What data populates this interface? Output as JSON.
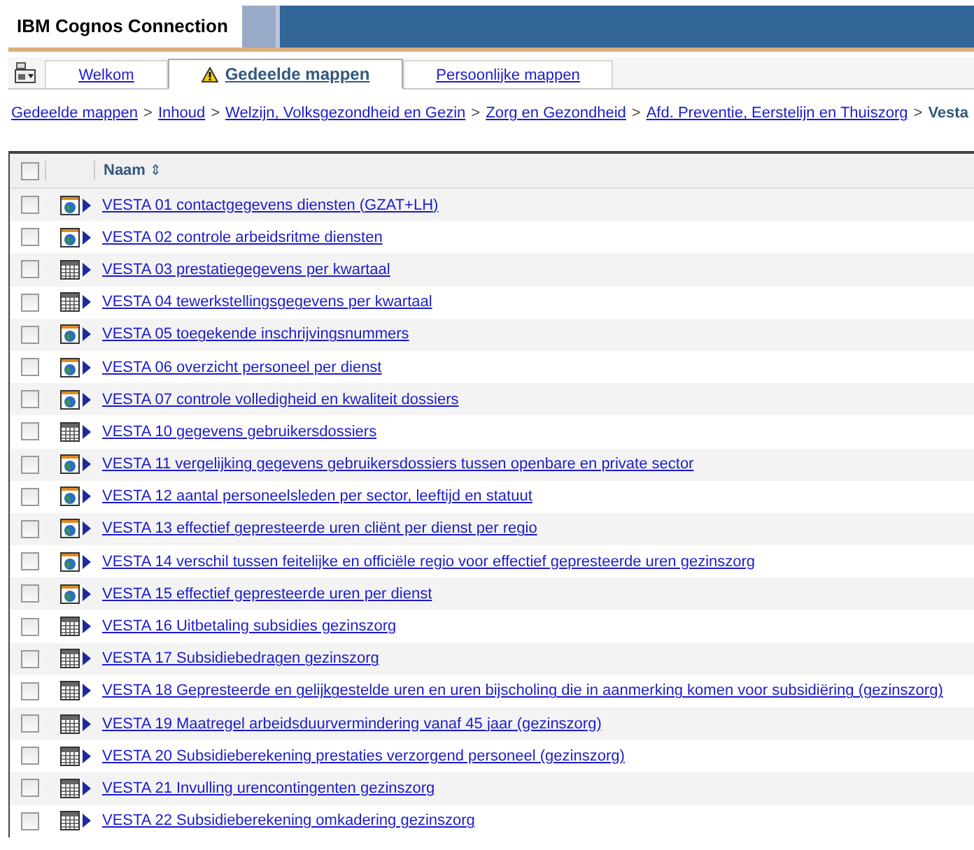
{
  "header": {
    "title": "IBM Cognos Connection"
  },
  "tabs": [
    {
      "label": "Welkom",
      "selected": false,
      "warning": false
    },
    {
      "label": "Gedeelde mappen",
      "selected": true,
      "warning": true
    },
    {
      "label": "Persoonlijke mappen",
      "selected": false,
      "warning": false
    }
  ],
  "breadcrumb": {
    "links": [
      "Gedeelde mappen",
      "Inhoud",
      "Welzijn, Volksgezondheid en Gezin",
      "Zorg en Gezondheid",
      "Afd. Preventie, Eerstelijn en Thuiszorg"
    ],
    "separator": ">",
    "current": "Vesta"
  },
  "table": {
    "header_checked": false,
    "columns": [
      "Naam"
    ],
    "sort_icon": "⇕",
    "rows": [
      {
        "kind": "report",
        "name": "VESTA 01 contactgegevens diensten (GZAT+LH)",
        "checked": false
      },
      {
        "kind": "report",
        "name": "VESTA 02 controle arbeidsritme diensten",
        "checked": false
      },
      {
        "kind": "analysis",
        "name": "VESTA 03 prestatiegegevens per kwartaal",
        "checked": false
      },
      {
        "kind": "analysis",
        "name": "VESTA 04 tewerkstellingsgegevens per kwartaal",
        "checked": false
      },
      {
        "kind": "report",
        "name": "VESTA 05 toegekende inschrijvingsnummers",
        "checked": false
      },
      {
        "kind": "report",
        "name": "VESTA 06 overzicht personeel per dienst",
        "checked": false
      },
      {
        "kind": "report",
        "name": "VESTA 07 controle volledigheid en kwaliteit dossiers",
        "checked": false
      },
      {
        "kind": "analysis",
        "name": "VESTA 10 gegevens gebruikersdossiers",
        "checked": false
      },
      {
        "kind": "report",
        "name": "VESTA 11 vergelijking gegevens gebruikersdossiers tussen openbare en private sector",
        "checked": false
      },
      {
        "kind": "report",
        "name": "VESTA 12 aantal personeelsleden per sector, leeftijd en statuut",
        "checked": false
      },
      {
        "kind": "report",
        "name": "VESTA 13 effectief gepresteerde uren cliënt per dienst per regio",
        "checked": false
      },
      {
        "kind": "report",
        "name": "VESTA 14 verschil tussen feitelijke en officiële regio voor effectief gepresteerde uren gezinszorg",
        "checked": false
      },
      {
        "kind": "report",
        "name": "VESTA 15 effectief gepresteerde uren per dienst",
        "checked": false
      },
      {
        "kind": "analysis",
        "name": "VESTA 16 Uitbetaling subsidies gezinszorg",
        "checked": false
      },
      {
        "kind": "analysis",
        "name": "VESTA 17 Subsidiebedragen gezinszorg",
        "checked": false
      },
      {
        "kind": "analysis",
        "name": "VESTA 18 Gepresteerde en gelijkgestelde uren en uren bijscholing die in aanmerking komen voor subsidiëring (gezinszorg)",
        "checked": false
      },
      {
        "kind": "analysis",
        "name": "VESTA 19 Maatregel arbeidsduurvermindering vanaf 45 jaar (gezinszorg)",
        "checked": false
      },
      {
        "kind": "analysis",
        "name": "VESTA 20 Subsidieberekening prestaties verzorgend personeel (gezinszorg)",
        "checked": false
      },
      {
        "kind": "analysis",
        "name": "VESTA 21 Invulling urencontingenten gezinszorg",
        "checked": false
      },
      {
        "kind": "analysis",
        "name": "VESTA 22 Subsidieberekening omkadering gezinszorg",
        "checked": false
      }
    ]
  }
}
